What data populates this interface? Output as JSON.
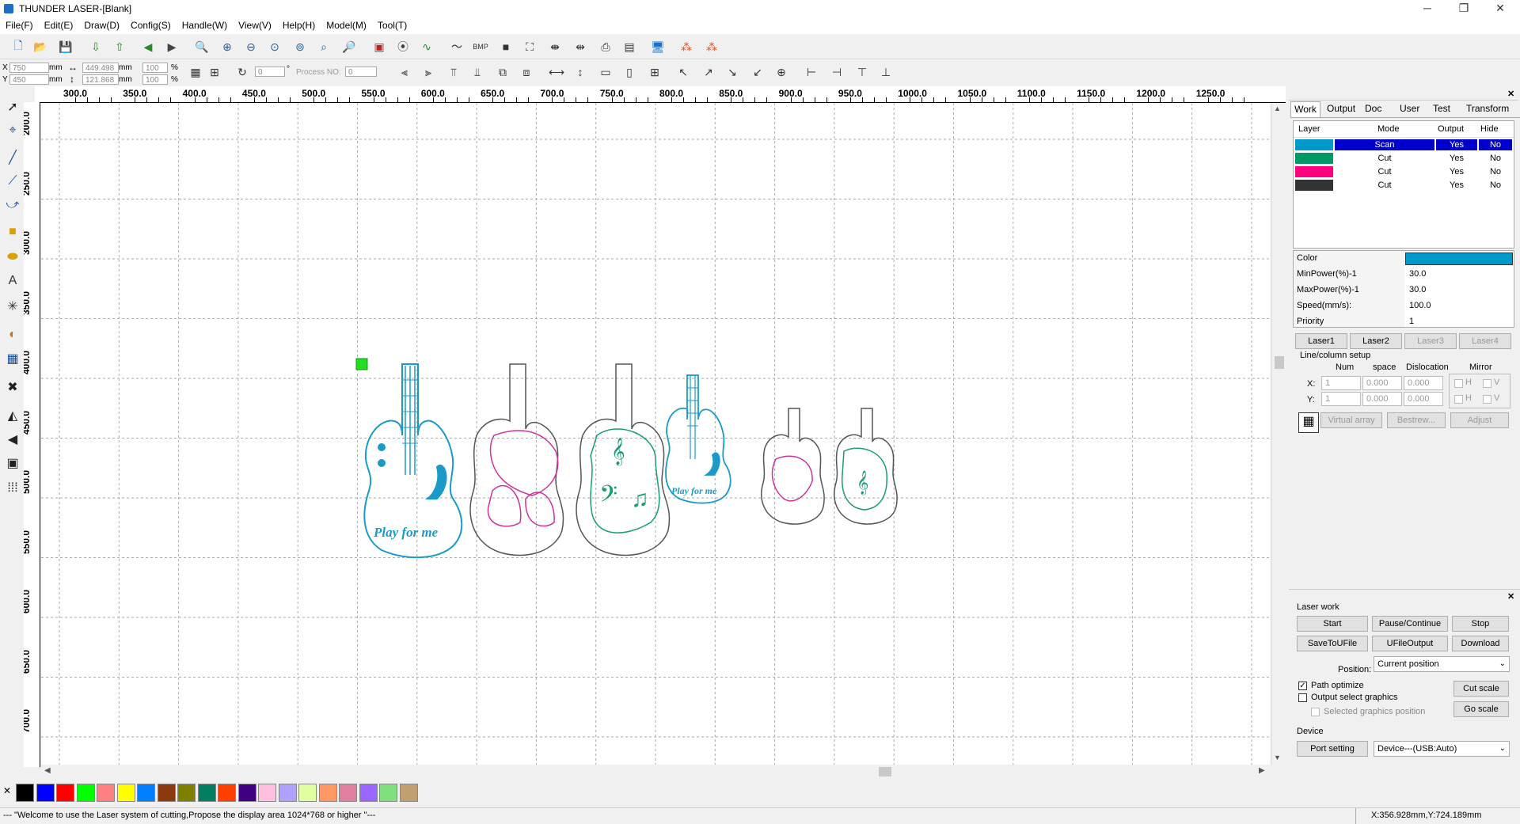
{
  "window": {
    "title": "THUNDER LASER-[Blank]",
    "controls": [
      "─",
      "❐",
      "✕"
    ]
  },
  "menu": [
    "File(F)",
    "Edit(E)",
    "Draw(D)",
    "Config(S)",
    "Handle(W)",
    "View(V)",
    "Help(H)",
    "Model(M)",
    "Tool(T)"
  ],
  "coords": {
    "x_label": "X",
    "y_label": "Y",
    "x_value": "750",
    "y_value": "450",
    "unit": "mm",
    "width": "449.498",
    "height": "121.868",
    "scale_x": "100",
    "scale_y": "100",
    "percent": "%",
    "angle": "0",
    "degree": "°",
    "process_label": "Process NO:",
    "process_value": "0"
  },
  "ruler": {
    "h_labels": [
      "300.0",
      "350.0",
      "400.0",
      "450.0",
      "500.0",
      "550.0",
      "600.0",
      "650.0",
      "700.0",
      "750.0",
      "800.0",
      "850.0",
      "900.0",
      "950.0",
      "1000.0",
      "1050.0",
      "1100.0",
      "1150.0",
      "1200.0",
      "1250.0"
    ],
    "v_labels": [
      "200.0",
      "250.0",
      "300.0",
      "350.0",
      "400.0",
      "450.0",
      "500.0",
      "550.0",
      "600.0",
      "650.0",
      "700.0"
    ]
  },
  "canvas_text": {
    "play_for_me": "Play for me"
  },
  "panel_tabs": [
    "Work",
    "Output",
    "Doc",
    "User",
    "Test",
    "Transform"
  ],
  "layer_table": {
    "headers": [
      "Layer",
      "Mode",
      "Output",
      "Hide"
    ],
    "rows": [
      {
        "color": "#0099cc",
        "mode": "Scan",
        "output": "Yes",
        "hide": "No"
      },
      {
        "color": "#009966",
        "mode": "Cut",
        "output": "Yes",
        "hide": "No"
      },
      {
        "color": "#ff0080",
        "mode": "Cut",
        "output": "Yes",
        "hide": "No"
      },
      {
        "color": "#333333",
        "mode": "Cut",
        "output": "Yes",
        "hide": "No"
      }
    ]
  },
  "props": {
    "color_label": "Color",
    "color_value": "#0099cc",
    "minpower_label": "MinPower(%)-1",
    "minpower_value": "30.0",
    "maxpower_label": "MaxPower(%)-1",
    "maxpower_value": "30.0",
    "speed_label": "Speed(mm/s):",
    "speed_value": "100.0",
    "priority_label": "Priority",
    "priority_value": "1"
  },
  "laser_buttons": [
    "Laser1",
    "Laser2",
    "Laser3",
    "Laser4"
  ],
  "array": {
    "title": "Line/column setup",
    "num": "Num",
    "space": "space",
    "dislocation": "Dislocation",
    "mirror": "Mirror",
    "x": "X:",
    "y": "Y:",
    "x_num": "1",
    "x_space": "0.000",
    "x_disloc": "0.000",
    "y_num": "1",
    "y_space": "0.000",
    "y_disloc": "0.000",
    "h": "H",
    "v": "V",
    "virtual_array": "Virtual array",
    "bestrew": "Bestrew...",
    "adjust": "Adjust"
  },
  "laserwork": {
    "title": "Laser work",
    "start": "Start",
    "pause": "Pause/Continue",
    "stop": "Stop",
    "save_u": "SaveToUFile",
    "ufile_out": "UFileOutput",
    "download": "Download",
    "position_label": "Position:",
    "position_value": "Current position",
    "path_optimize": "Path optimize",
    "output_select": "Output select graphics",
    "selected_pos": "Selected graphics position",
    "cut_scale": "Cut scale",
    "go_scale": "Go scale",
    "device_title": "Device",
    "port_setting": "Port setting",
    "device_value": "Device---(USB:Auto)"
  },
  "palette": [
    "#000000",
    "#0000ff",
    "#ff0000",
    "#00ff00",
    "#ff8080",
    "#ffff00",
    "#0080ff",
    "#8b3a0f",
    "#808000",
    "#008060",
    "#ff4000",
    "#400080",
    "#ffc0e0",
    "#b0a0ff",
    "#e0ffa0",
    "#ff9966",
    "#e080a0",
    "#9966ff",
    "#80e080",
    "#c0a070"
  ],
  "status": {
    "message": "--- \"Welcome to use the Laser system of cutting,Propose the display area 1024*768 or higher \"---",
    "position": "X:356.928mm,Y:724.189mm"
  },
  "colors": {
    "scan": "#1a9bc7",
    "cut_green": "#1a9b7a",
    "cut_pink": "#cc3399",
    "cut_dark": "#555555",
    "selected": "#0000cc"
  }
}
